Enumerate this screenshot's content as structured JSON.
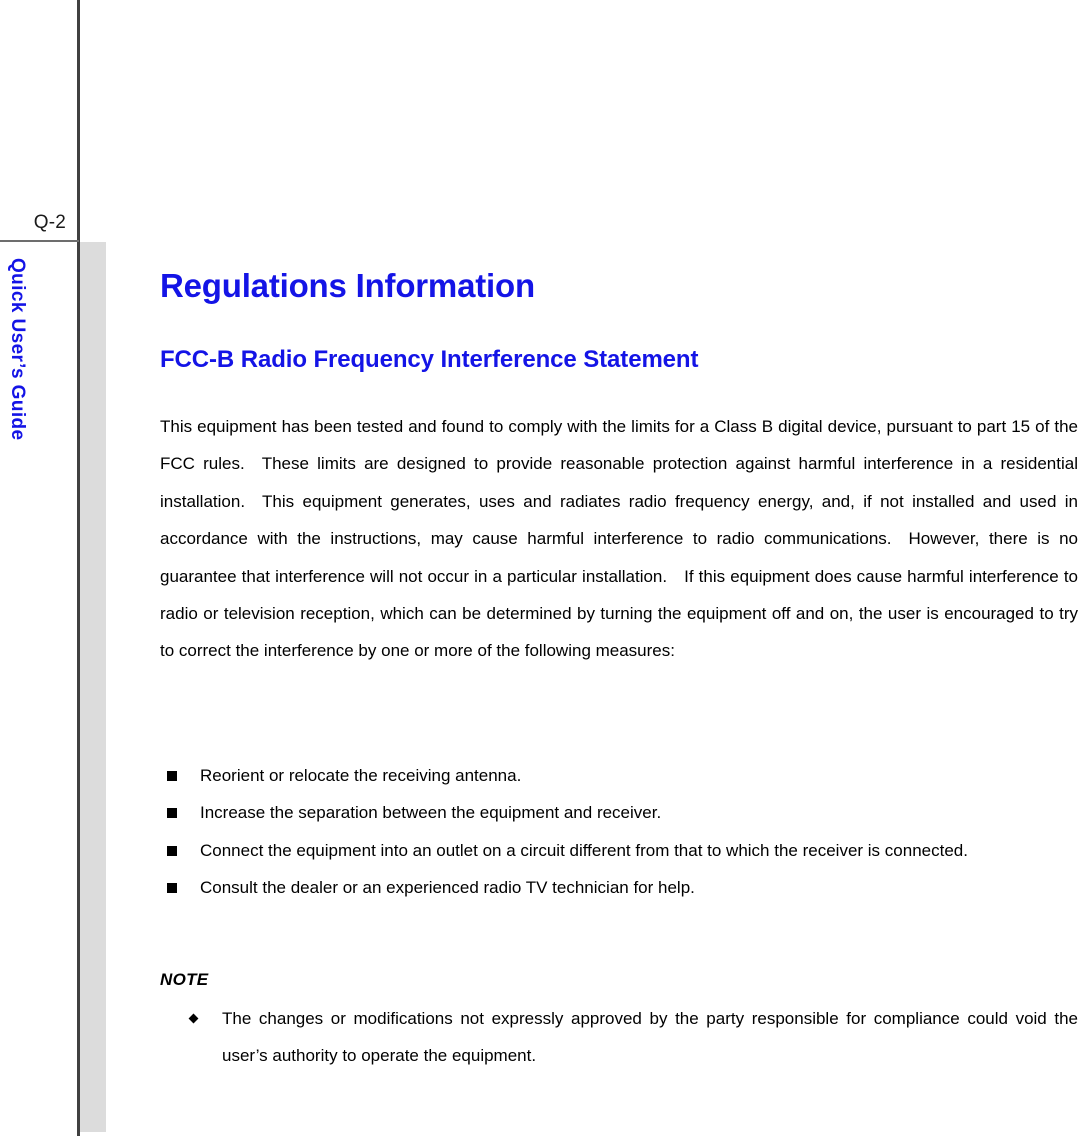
{
  "page": {
    "folio": "Q-2",
    "running_head": "Quick User’s Guide",
    "accent_color": "#1414e6",
    "rule_color": "#404040",
    "band_color": "#dcdcdc"
  },
  "content": {
    "title": "Regulations Information",
    "subtitle": "FCC-B Radio Frequency Interference Statement",
    "paragraph": "This equipment has been tested and found to comply with the limits for a Class B digital device, pursuant to part 15 of the FCC rules. These limits are designed to provide reasonable protection against harmful interference in a residential installation. This equipment generates, uses and radiates radio frequency energy, and, if not installed and used in accordance with the instructions, may cause harmful interference to radio communications. However, there is no guarantee that interference will not occur in a particular installation. If this equipment does cause harmful interference to radio or television reception, which can be determined by turning the equipment off and on, the user is encouraged to try to correct the interference by one or more of the following measures:",
    "measures": [
      "Reorient or relocate the receiving antenna.",
      "Increase the separation between the equipment and receiver.",
      "Connect the equipment into an outlet on a circuit different from that to which the receiver is connected.",
      "Consult the dealer or an experienced radio TV technician for help."
    ],
    "note": {
      "heading": "NOTE",
      "items": [
        "The changes or modifications not expressly approved by the party responsible for compliance could void the user’s authority to operate the equipment."
      ]
    }
  }
}
